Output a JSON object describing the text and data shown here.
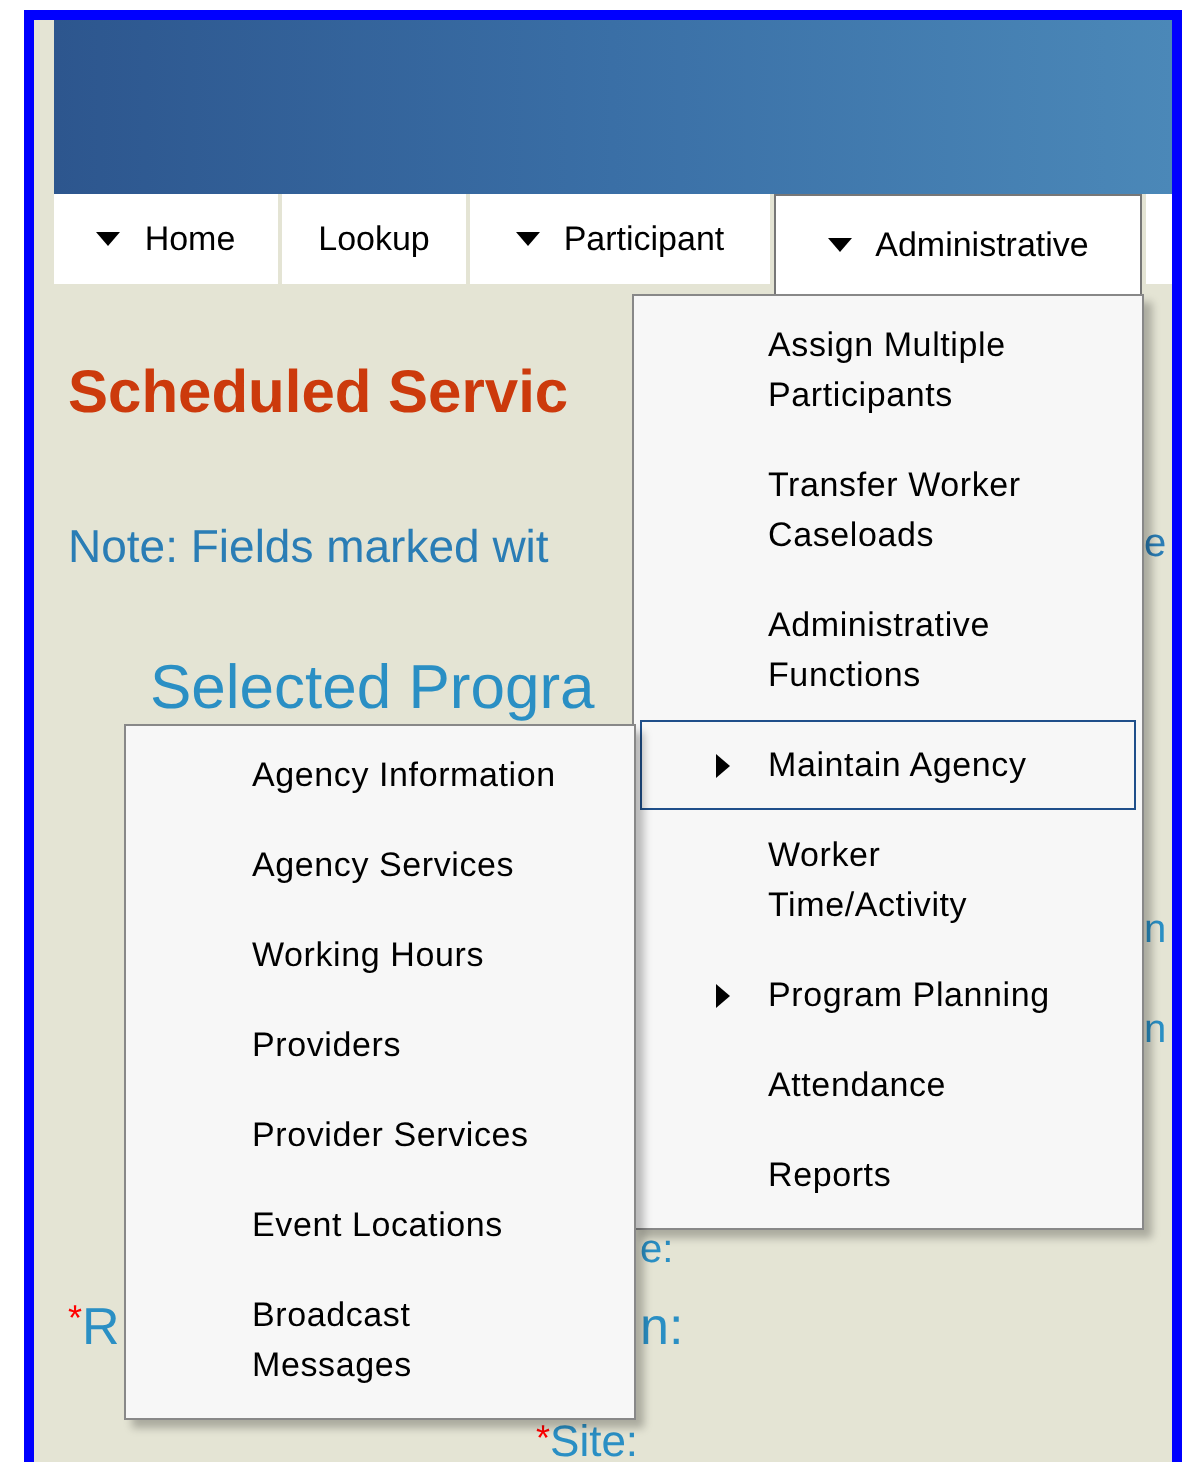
{
  "nav": [
    {
      "label": "Home",
      "has_menu": true,
      "selected": false
    },
    {
      "label": "Lookup",
      "has_menu": false,
      "selected": false
    },
    {
      "label": "Participant",
      "has_menu": true,
      "selected": false
    },
    {
      "label": "Administrative",
      "has_menu": true,
      "selected": true
    }
  ],
  "page": {
    "title": "Scheduled Servic",
    "note": "Note: Fields marked wit",
    "note_tail": "e",
    "section": "Selected Progra",
    "fragments": [
      {
        "text": "n"
      },
      {
        "text": "n"
      },
      {
        "text": "e:"
      },
      {
        "asterisk": "*",
        "text": "R"
      },
      {
        "text": "n:"
      },
      {
        "asterisk": "*",
        "text": "Site:"
      }
    ]
  },
  "admin_menu": [
    {
      "label": "Assign Multiple\nParticipants",
      "submenu": false,
      "selected": false
    },
    {
      "label": "Transfer Worker\nCaseloads",
      "submenu": false,
      "selected": false
    },
    {
      "label": "Administrative\nFunctions",
      "submenu": false,
      "selected": false
    },
    {
      "label": "Maintain Agency",
      "submenu": true,
      "selected": true
    },
    {
      "label": "Worker\nTime/Activity",
      "submenu": false,
      "selected": false
    },
    {
      "label": "Program Planning",
      "submenu": true,
      "selected": false
    },
    {
      "label": "Attendance",
      "submenu": false,
      "selected": false
    },
    {
      "label": "Reports",
      "submenu": false,
      "selected": false
    }
  ],
  "agency_menu": [
    {
      "label": "Agency Information"
    },
    {
      "label": "Agency Services"
    },
    {
      "label": "Working Hours"
    },
    {
      "label": "Providers"
    },
    {
      "label": "Provider Services"
    },
    {
      "label": "Event Locations"
    },
    {
      "label": "Broadcast\nMessages"
    }
  ]
}
